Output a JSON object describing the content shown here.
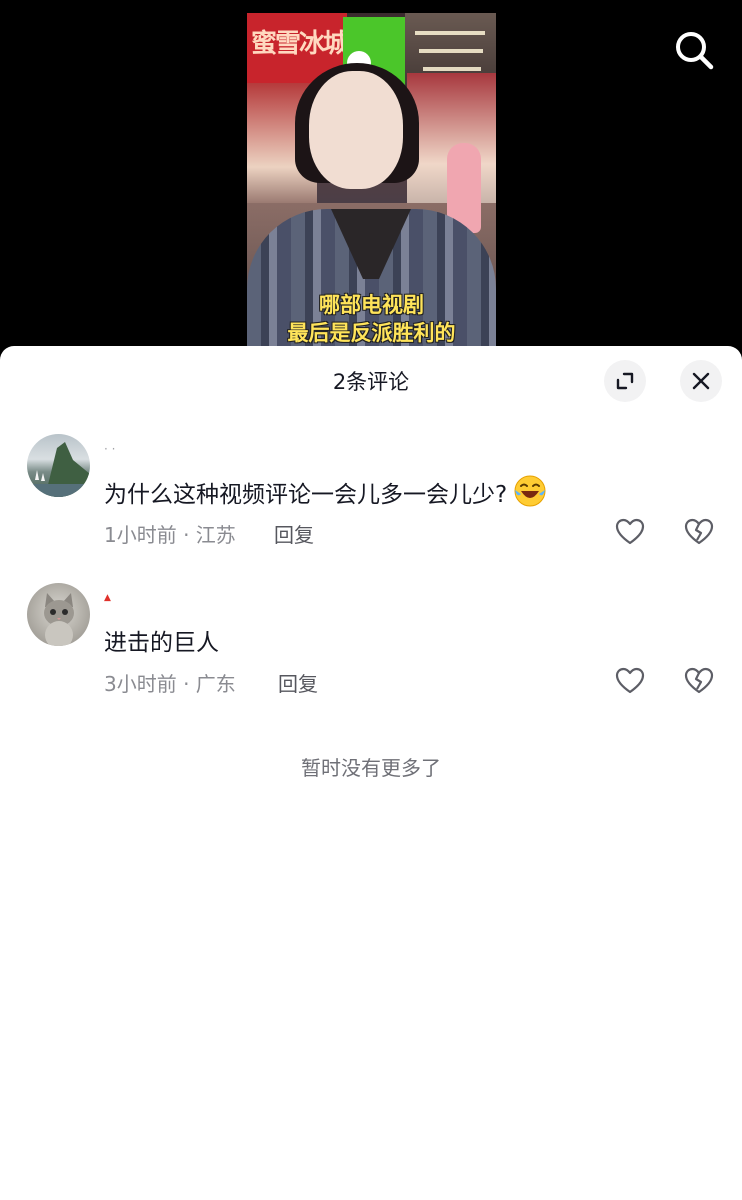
{
  "video": {
    "caption_line1": "哪部电视剧",
    "caption_line2": "最后是反派胜利的",
    "sign_text": "蜜雪冰城"
  },
  "header": {
    "search_icon": "search-icon"
  },
  "sheet": {
    "title": "2条评论",
    "expand_icon": "expand-icon",
    "close_icon": "close-icon"
  },
  "comments": [
    {
      "username": "· ·",
      "text": "为什么这种视频评论一会儿多一会儿少?",
      "emoji": "laughing-tears-emoji",
      "meta": "1小时前 · 江苏",
      "reply_label": "回复"
    },
    {
      "username": "▲",
      "text": "进击的巨人",
      "meta": "3小时前 · 广东",
      "reply_label": "回复"
    }
  ],
  "footer": {
    "no_more": "暂时没有更多了"
  },
  "colors": {
    "caption": "#ffe45a",
    "sheet_bg": "#ffffff",
    "text_primary": "#161823",
    "text_secondary": "#8a8b91"
  }
}
